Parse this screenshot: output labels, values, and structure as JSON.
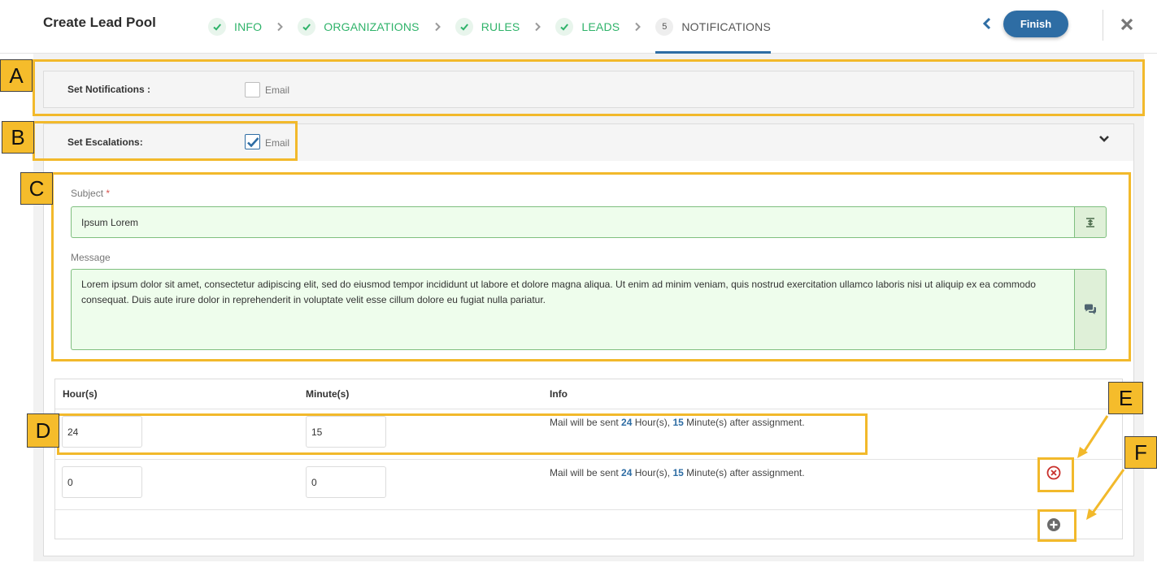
{
  "header": {
    "title": "Create Lead Pool",
    "steps": [
      {
        "label": "INFO",
        "state": "done"
      },
      {
        "label": "ORGANIZATIONS",
        "state": "done"
      },
      {
        "label": "RULES",
        "state": "done"
      },
      {
        "label": "LEADS",
        "state": "done"
      },
      {
        "label": "NOTIFICATIONS",
        "state": "active",
        "number": "5"
      }
    ],
    "finish_label": "Finish",
    "icons": {
      "back": "chevron-left-icon",
      "close": "close-icon",
      "done": "check-icon",
      "separator": "chevron-right-icon"
    }
  },
  "notifications": {
    "label": "Set Notifications :",
    "email_label": "Email",
    "email_checked": false
  },
  "escalations": {
    "label": "Set Escalations:",
    "email_label": "Email",
    "email_checked": true,
    "subject_label": "Subject",
    "subject_required": "*",
    "subject_value": "Ipsum Lorem",
    "message_label": "Message",
    "message_value": "Lorem ipsum dolor sit amet, consectetur adipiscing elit, sed do eiusmod tempor incididunt ut labore et dolore magna aliqua. Ut enim ad minim veniam, quis nostrud exercitation ullamco laboris nisi ut aliquip ex ea commodo consequat. Duis aute irure dolor in reprehenderit in voluptate velit esse cillum dolore eu fugiat nulla pariatur."
  },
  "schedule": {
    "columns": [
      "Hour(s)",
      "Minute(s)",
      "Info"
    ],
    "info_prefix": "Mail will be sent",
    "hours_unit": "Hour(s),",
    "minutes_unit": "Minute(s) after assignment.",
    "rows": [
      {
        "hours": "24",
        "minutes": "15",
        "info_hours": "24",
        "info_minutes": "15"
      },
      {
        "hours": "0",
        "minutes": "0",
        "info_hours": "24",
        "info_minutes": "15"
      }
    ]
  },
  "annotations": [
    "A",
    "B",
    "C",
    "D",
    "E",
    "F"
  ],
  "colors": {
    "accent": "#2e6da4",
    "success": "#2fb36a",
    "highlight": "#f2b92b",
    "danger": "#c9302c"
  }
}
